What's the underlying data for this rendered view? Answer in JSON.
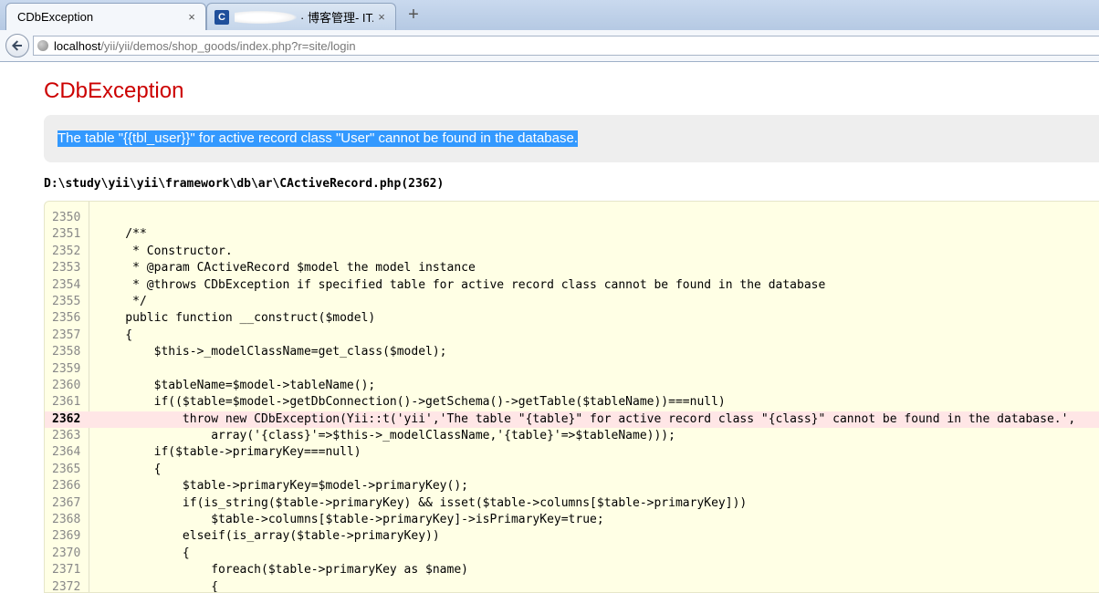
{
  "browser": {
    "tabs": [
      {
        "title": "CDbException",
        "close": "×"
      },
      {
        "favicon": "C",
        "title": "· 博客管理- IT...",
        "close": "×"
      }
    ],
    "new_tab": "+",
    "url_host": "localhost",
    "url_path": "/yii/yii/demos/shop_goods/index.php?r=site/login"
  },
  "error": {
    "title": "CDbException",
    "message": "The table \"{{tbl_user}}\" for active record class \"User\" cannot be found in the database.",
    "file": "D:\\study\\yii\\yii\\framework\\db\\ar\\CActiveRecord.php(2362)"
  },
  "source": {
    "error_line": "2362",
    "lines": [
      {
        "no": "2350",
        "code": ""
      },
      {
        "no": "2351",
        "code": "    /**"
      },
      {
        "no": "2352",
        "code": "     * Constructor."
      },
      {
        "no": "2353",
        "code": "     * @param CActiveRecord $model the model instance"
      },
      {
        "no": "2354",
        "code": "     * @throws CDbException if specified table for active record class cannot be found in the database"
      },
      {
        "no": "2355",
        "code": "     */"
      },
      {
        "no": "2356",
        "code": "    public function __construct($model)"
      },
      {
        "no": "2357",
        "code": "    {"
      },
      {
        "no": "2358",
        "code": "        $this->_modelClassName=get_class($model);"
      },
      {
        "no": "2359",
        "code": ""
      },
      {
        "no": "2360",
        "code": "        $tableName=$model->tableName();"
      },
      {
        "no": "2361",
        "code": "        if(($table=$model->getDbConnection()->getSchema()->getTable($tableName))===null)"
      },
      {
        "no": "2362",
        "code": "            throw new CDbException(Yii::t('yii','The table \"{table}\" for active record class \"{class}\" cannot be found in the database.',"
      },
      {
        "no": "2363",
        "code": "                array('{class}'=>$this->_modelClassName,'{table}'=>$tableName)));"
      },
      {
        "no": "2364",
        "code": "        if($table->primaryKey===null)"
      },
      {
        "no": "2365",
        "code": "        {"
      },
      {
        "no": "2366",
        "code": "            $table->primaryKey=$model->primaryKey();"
      },
      {
        "no": "2367",
        "code": "            if(is_string($table->primaryKey) && isset($table->columns[$table->primaryKey]))"
      },
      {
        "no": "2368",
        "code": "                $table->columns[$table->primaryKey]->isPrimaryKey=true;"
      },
      {
        "no": "2369",
        "code": "            elseif(is_array($table->primaryKey))"
      },
      {
        "no": "2370",
        "code": "            {"
      },
      {
        "no": "2371",
        "code": "                foreach($table->primaryKey as $name)"
      },
      {
        "no": "2372",
        "code": "                {"
      }
    ]
  }
}
